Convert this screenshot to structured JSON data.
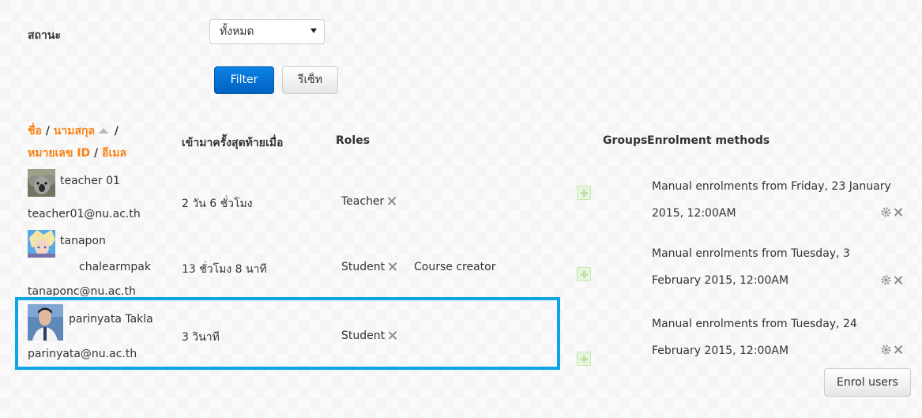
{
  "filter": {
    "status_label": "สถานะ",
    "status_value": "ทั้งหมด",
    "filter_button": "Filter",
    "reset_button": "รีเซ็ท"
  },
  "table": {
    "headers": {
      "first_name": "ชื่อ",
      "separator1": " / ",
      "last_name": "นามสกุล",
      "separator2": " /",
      "id_number": "หมายเลข ID",
      "separator3": " / ",
      "email": "อีเมล",
      "last_access": "เข้ามาครั้งสุดท้ายเมื่อ",
      "roles": "Roles",
      "groups": "Groups",
      "enrolment_methods": "Enrolment methods"
    },
    "rows": [
      {
        "name": "teacher 01",
        "email": "teacher01@nu.ac.th",
        "last_access": "2 วัน 6 ชั่วโมง",
        "role1": "Teacher",
        "role2": "",
        "enrol_line1": "Manual enrolments from Friday, 23 January",
        "enrol_line2": "2015, 12:00AM"
      },
      {
        "name_line1": "tanapon",
        "name_line2": "chalearmpak",
        "email": "tanaponc@nu.ac.th",
        "last_access": "13 ชั่วโมง 8 นาที",
        "role1": "Student",
        "role2": "Course creator",
        "enrol_line1": "Manual enrolments from Tuesday, 3",
        "enrol_line2": "February 2015, 12:00AM"
      },
      {
        "name": "parinyata Takla",
        "email": "parinyata@nu.ac.th",
        "last_access": "3 วินาที",
        "role1": "Student",
        "role2": "",
        "enrol_line1": "Manual enrolments from Tuesday, 24",
        "enrol_line2": "February 2015, 12:00AM"
      }
    ]
  },
  "enrol_users_button": "Enrol users",
  "colors": {
    "accent_link": "#f98012",
    "primary_button": "#0a6fd4",
    "highlight_border": "#0ea5e6"
  }
}
